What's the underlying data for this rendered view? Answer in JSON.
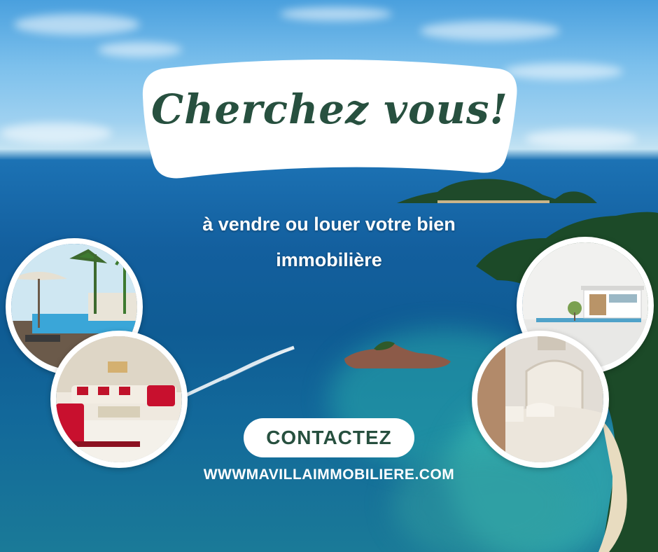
{
  "banner": {
    "title": "Cherchez vous!",
    "subtitle_line1": "à vendre ou louer votre bien",
    "subtitle_line2": "immobilière"
  },
  "cta": {
    "label": "CONTACTEZ"
  },
  "website": {
    "url_text": "WWWMAVILLAIMMOBILIERE.COM"
  },
  "photos": [
    {
      "subject": "resort-pool"
    },
    {
      "subject": "living-room"
    },
    {
      "subject": "modern-house-model"
    },
    {
      "subject": "bedroom"
    }
  ],
  "colors": {
    "title_text": "#27503f",
    "cta_text": "#27503f",
    "banner_bg": "#ffffff",
    "sea": "#135f9e",
    "sky": "#7cc0ec"
  }
}
